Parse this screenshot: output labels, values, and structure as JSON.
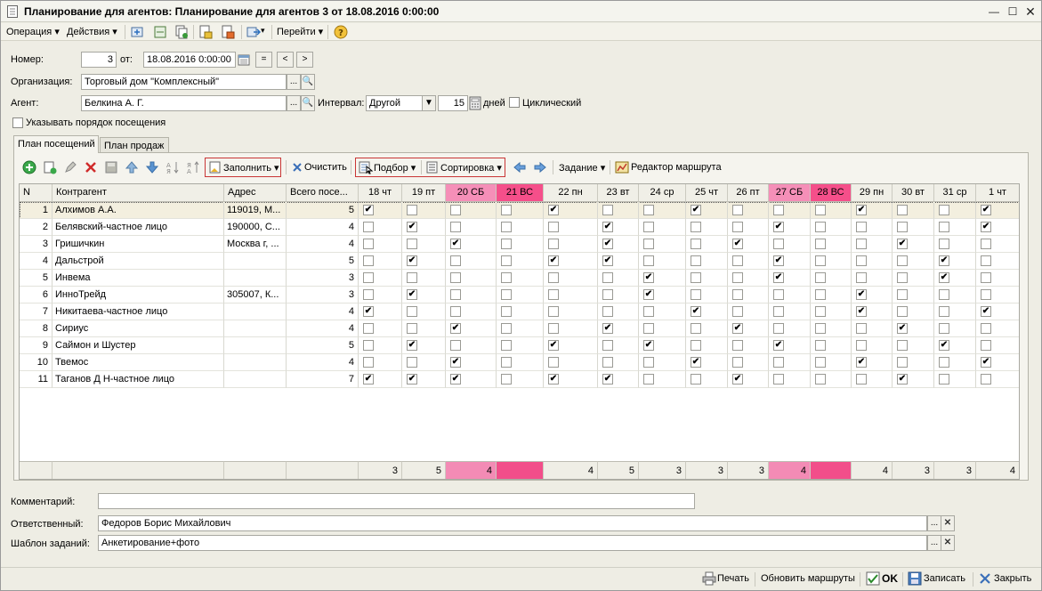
{
  "window": {
    "title": "Планирование для агентов: Планирование для агентов 3 от 18.08.2016 0:00:00"
  },
  "menu": {
    "operation": "Операция ▾",
    "actions": "Действия ▾",
    "goto": "Перейти ▾"
  },
  "header": {
    "number_label": "Номер:",
    "number_value": "3",
    "from_label": "от:",
    "date_value": "18.08.2016  0:00:00",
    "eq_btn": "=",
    "prev_btn": "<",
    "next_btn": ">",
    "org_label": "Организация:",
    "org_value": "Торговый дом \"Комплексный\"",
    "agent_label": "Агент:",
    "agent_value": "Белкина А. Г.",
    "interval_label": "Интервал:",
    "interval_value": "Другой",
    "days_value": "15",
    "days_label": "дней",
    "cyclic_label": "Циклический",
    "order_label": "Указывать порядок посещения"
  },
  "tabs": [
    "План посещений",
    "План продаж"
  ],
  "toolbar": {
    "fill": "Заполнить ▾",
    "clear": "Очистить",
    "pick": "Подбор ▾",
    "sort": "Сортировка ▾",
    "task": "Задание ▾",
    "route_editor": "Редактор маршрута"
  },
  "grid": {
    "columns": [
      "N",
      "Контрагент",
      "Адрес",
      "Всего посе..."
    ],
    "days": [
      {
        "label": "18 чт",
        "weekend": false
      },
      {
        "label": "19 пт",
        "weekend": false
      },
      {
        "label": "20 СБ",
        "weekend": "sat"
      },
      {
        "label": "21 ВС",
        "weekend": "sun"
      },
      {
        "label": "22 пн",
        "weekend": false
      },
      {
        "label": "23 вт",
        "weekend": false
      },
      {
        "label": "24 ср",
        "weekend": false
      },
      {
        "label": "25 чт",
        "weekend": false
      },
      {
        "label": "26 пт",
        "weekend": false
      },
      {
        "label": "27 СБ",
        "weekend": "sat"
      },
      {
        "label": "28 ВС",
        "weekend": "sun"
      },
      {
        "label": "29 пн",
        "weekend": false
      },
      {
        "label": "30 вт",
        "weekend": false
      },
      {
        "label": "31 ср",
        "weekend": false
      },
      {
        "label": "1 чт",
        "weekend": false
      }
    ],
    "rows": [
      {
        "n": "1",
        "name": "Алхимов А.А.",
        "addr": "119019, М...",
        "total": "5",
        "checks": [
          1,
          0,
          0,
          0,
          1,
          0,
          0,
          1,
          0,
          0,
          0,
          1,
          0,
          0,
          1
        ]
      },
      {
        "n": "2",
        "name": "Белявский-частное лицо",
        "addr": "190000, С...",
        "total": "4",
        "checks": [
          0,
          1,
          0,
          0,
          0,
          1,
          0,
          0,
          0,
          1,
          0,
          0,
          0,
          0,
          1
        ]
      },
      {
        "n": "3",
        "name": "Гришичкин",
        "addr": "Москва г, ...",
        "total": "4",
        "checks": [
          0,
          0,
          1,
          0,
          0,
          1,
          0,
          0,
          1,
          0,
          0,
          0,
          1,
          0,
          0
        ]
      },
      {
        "n": "4",
        "name": "Дальстрой",
        "addr": "",
        "total": "5",
        "checks": [
          0,
          1,
          0,
          0,
          1,
          1,
          0,
          0,
          0,
          1,
          0,
          0,
          0,
          1,
          0
        ]
      },
      {
        "n": "5",
        "name": "Инвема",
        "addr": "",
        "total": "3",
        "checks": [
          0,
          0,
          0,
          0,
          0,
          0,
          1,
          0,
          0,
          1,
          0,
          0,
          0,
          1,
          0
        ]
      },
      {
        "n": "6",
        "name": "ИнноТрейд",
        "addr": "305007, К...",
        "total": "3",
        "checks": [
          0,
          1,
          0,
          0,
          0,
          0,
          1,
          0,
          0,
          0,
          0,
          1,
          0,
          0,
          0
        ]
      },
      {
        "n": "7",
        "name": "Никитаева-частное лицо",
        "addr": "",
        "total": "4",
        "checks": [
          1,
          0,
          0,
          0,
          0,
          0,
          0,
          1,
          0,
          0,
          0,
          1,
          0,
          0,
          1
        ]
      },
      {
        "n": "8",
        "name": "Сириус",
        "addr": "",
        "total": "4",
        "checks": [
          0,
          0,
          1,
          0,
          0,
          1,
          0,
          0,
          1,
          0,
          0,
          0,
          1,
          0,
          0
        ]
      },
      {
        "n": "9",
        "name": "Саймон и Шустер",
        "addr": "",
        "total": "5",
        "checks": [
          0,
          1,
          0,
          0,
          1,
          0,
          1,
          0,
          0,
          1,
          0,
          0,
          0,
          1,
          0
        ]
      },
      {
        "n": "10",
        "name": "Твемос",
        "addr": "",
        "total": "4",
        "checks": [
          0,
          0,
          1,
          0,
          0,
          0,
          0,
          1,
          0,
          0,
          0,
          1,
          0,
          0,
          1
        ]
      },
      {
        "n": "11",
        "name": "Таганов Д Н-частное лицо",
        "addr": "",
        "total": "7",
        "checks": [
          1,
          1,
          1,
          0,
          1,
          1,
          0,
          0,
          1,
          0,
          0,
          0,
          1,
          0,
          0
        ]
      }
    ],
    "footer": [
      "3",
      "5",
      "4",
      "",
      "4",
      "5",
      "3",
      "3",
      "3",
      "4",
      "",
      "4",
      "3",
      "3",
      "4"
    ]
  },
  "footer_fields": {
    "comment_label": "Комментарий:",
    "comment_value": "",
    "responsible_label": "Ответственный:",
    "responsible_value": "Федоров Борис Михайлович",
    "template_label": "Шаблон заданий:",
    "template_value": "Анкетирование+фото"
  },
  "bottom": {
    "print": "Печать",
    "update_routes": "Обновить маршруты",
    "ok": "OK",
    "save": "Записать",
    "close": "Закрыть"
  },
  "colors": {
    "sat_header": "#f58fb8",
    "sun_header": "#f54f8a",
    "sat_footer": "#f38bb5",
    "sun_footer": "#f24e8a",
    "selected_row": "#f3efdf"
  }
}
